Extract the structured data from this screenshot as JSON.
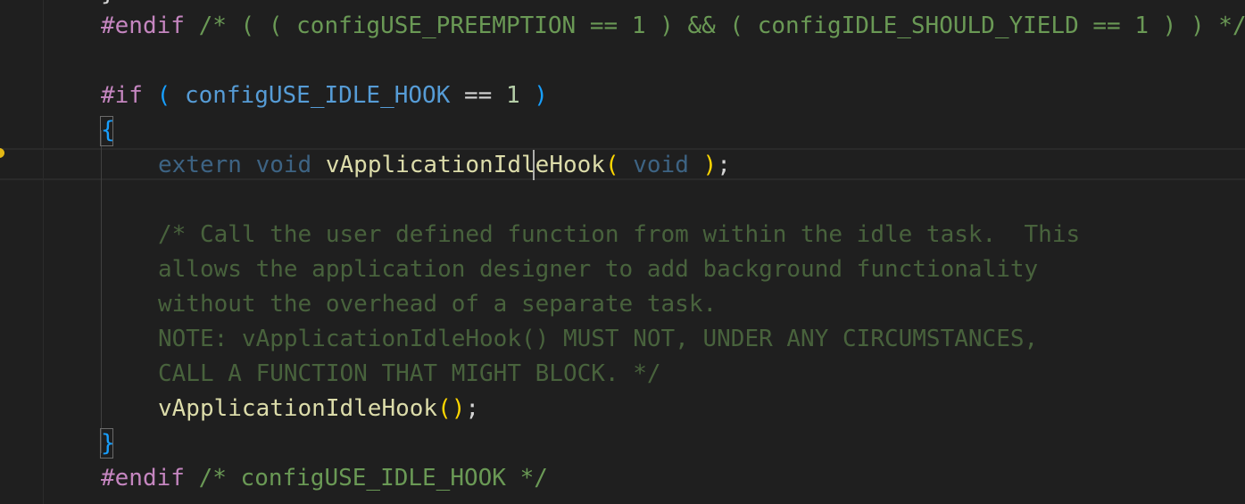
{
  "editor": {
    "colors": {
      "background": "#1f1f1f",
      "directive": "#c586c0",
      "comment": "#6a9955",
      "macro": "#569cd6",
      "number": "#b5cea8",
      "function": "#dcdcaa",
      "paren_gold": "#ffd700",
      "paren_blue": "#179fff"
    },
    "icons": {
      "lightbulb": "lightbulb-icon"
    },
    "lines": {
      "l0": {
        "tokens": [
          "}"
        ]
      },
      "l1": {
        "t1": "#endif",
        "t2": " /* ( ( configUSE_PREEMPTION == 1 ) && ( configIDLE_SHOULD_YIELD == 1 ) ) */"
      },
      "l3": {
        "t1": "#if",
        "t2": " ",
        "t3": "(",
        "t4": " ",
        "t5": "configUSE_IDLE_HOOK",
        "t6": " == ",
        "t7": "1",
        "t8": " ",
        "t9": ")"
      },
      "l4": {
        "t1": "{"
      },
      "l5": {
        "t1": "extern",
        "t2": " ",
        "t3": "void",
        "t4": " ",
        "t5": "vApplicationIdleHook",
        "t6": "(",
        "t7": " ",
        "t8": "void",
        "t9": " ",
        "t10": ")",
        "t11": ";"
      },
      "l7": {
        "t1": "/* Call the user defined function from within the idle task.  This"
      },
      "l8": {
        "t1": "allows the application designer to add background functionality"
      },
      "l9": {
        "t1": "without the overhead of a separate task."
      },
      "l10": {
        "t1": "NOTE: vApplicationIdleHook() MUST NOT, UNDER ANY CIRCUMSTANCES,"
      },
      "l11": {
        "t1": "CALL A FUNCTION THAT MIGHT BLOCK. */"
      },
      "l12": {
        "t1": "vApplicationIdleHook",
        "t2": "()",
        "t3": ";"
      },
      "l13": {
        "t1": "}"
      },
      "l14": {
        "t1": "#endif",
        "t2": " /* configUSE_IDLE_HOOK */"
      }
    }
  }
}
